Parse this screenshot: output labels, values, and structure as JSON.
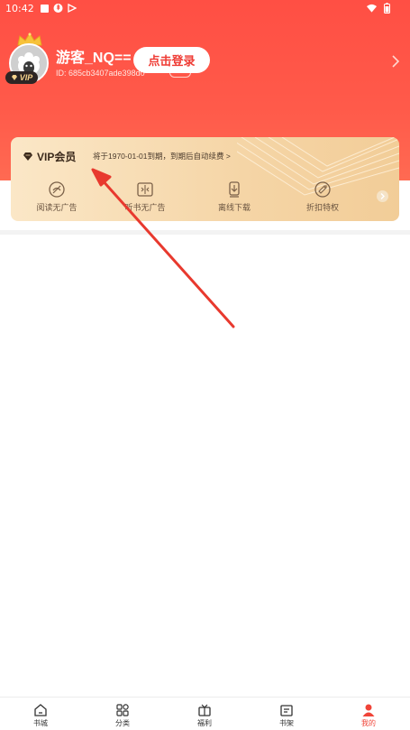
{
  "status_bar": {
    "time": "10:42",
    "left_icons": [
      "sim-icon",
      "bluetooth-icon",
      "play-icon"
    ],
    "right_icons": [
      "wifi-icon",
      "battery-icon"
    ]
  },
  "profile": {
    "username": "游客_NQ==",
    "user_id": "ID: 685cb3407ade398d0",
    "vip_badge": "VIP",
    "login_button": "点击登录"
  },
  "vip_card": {
    "title": "VIP会员",
    "expire_text": "将于1970-01-01到期，到期后自动续费 >",
    "benefits": [
      {
        "label": "阅读无广告",
        "icon": "no-ad-read-icon"
      },
      {
        "label": "听书无广告",
        "icon": "audiobook-icon"
      },
      {
        "label": "离线下载",
        "icon": "download-icon"
      },
      {
        "label": "折扣特权",
        "icon": "discount-tag-icon"
      }
    ]
  },
  "tabbar": {
    "tabs": [
      {
        "label": "书城",
        "icon": "home-icon",
        "active": false
      },
      {
        "label": "分类",
        "icon": "category-icon",
        "active": false
      },
      {
        "label": "福利",
        "icon": "gift-icon",
        "active": false
      },
      {
        "label": "书架",
        "icon": "bookshelf-icon",
        "active": false
      },
      {
        "label": "我的",
        "icon": "user-icon",
        "active": true
      }
    ]
  },
  "colors": {
    "header_red": "#ff5246",
    "accent_red": "#f04438",
    "vip_gold": "#f5d5a6",
    "arrow_red": "#e8392e"
  }
}
